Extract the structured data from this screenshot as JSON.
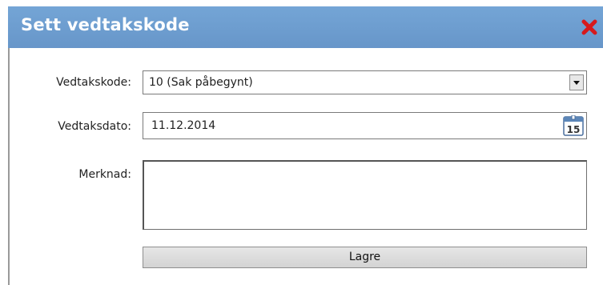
{
  "dialog": {
    "title": "Sett vedtakskode",
    "close_icon": "close-icon",
    "colors": {
      "title_bar": "#6d9fd1",
      "close": "#d7191c"
    }
  },
  "form": {
    "vedtakskode": {
      "label": "Vedtakskode:",
      "value": "10 (Sak påbegynt)",
      "icon": "chevron-down-icon"
    },
    "vedtaksdato": {
      "label": "Vedtaksdato:",
      "value": "11.12.2014",
      "icon": "calendar-icon",
      "calendar_day": "15"
    },
    "merknad": {
      "label": "Merknad:",
      "value": ""
    },
    "save_label": "Lagre"
  }
}
